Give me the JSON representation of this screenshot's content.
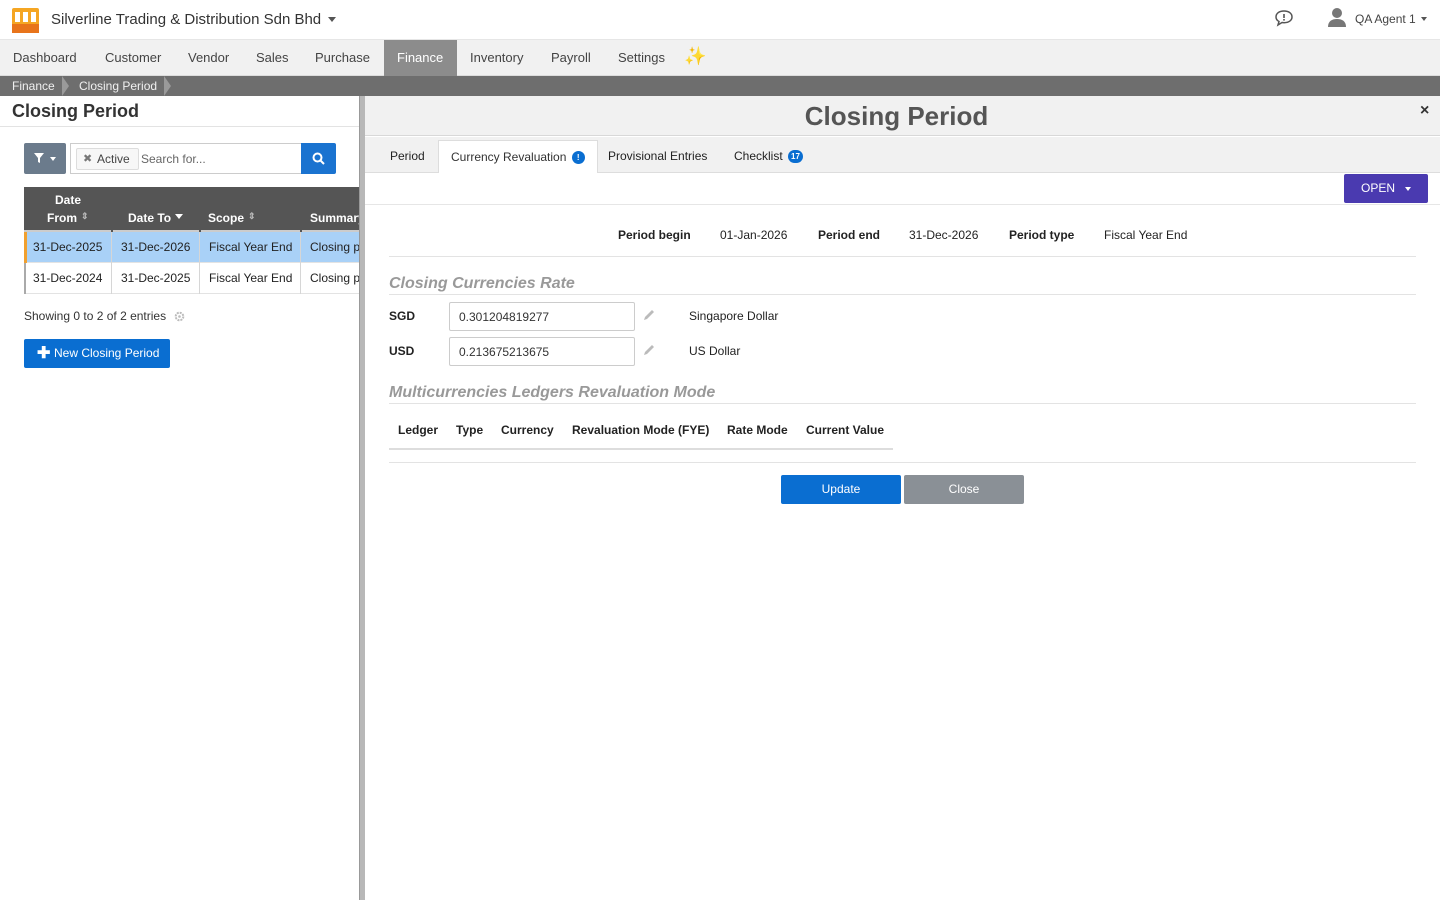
{
  "topbar": {
    "company": "Silverline Trading & Distribution Sdn Bhd",
    "user_name": "QA Agent 1"
  },
  "nav": [
    "Dashboard",
    "Customer",
    "Vendor",
    "Sales",
    "Purchase",
    "Finance",
    "Inventory",
    "Payroll",
    "Settings"
  ],
  "nav_active": "Finance",
  "breadcrumb": [
    "Finance",
    "Closing Period"
  ],
  "left": {
    "title": "Closing Period",
    "filter_tag": "Active",
    "search_placeholder": "Search for...",
    "columns": [
      "Date",
      "From",
      "Date To",
      "Scope",
      "Summary"
    ],
    "rows": [
      {
        "from": "31-Dec-2025",
        "to": "31-Dec-2026",
        "scope": "Fiscal Year End",
        "summary": "Closing p"
      },
      {
        "from": "31-Dec-2024",
        "to": "31-Dec-2025",
        "scope": "Fiscal Year End",
        "summary": "Closing p"
      }
    ],
    "showing": "Showing 0 to 2 of 2 entries",
    "new_button": "New Closing Period"
  },
  "panel": {
    "title": "Closing Period",
    "close": "×",
    "tabs": [
      {
        "label": "Period",
        "badge": ""
      },
      {
        "label": "Currency Revaluation",
        "badge": "!"
      },
      {
        "label": "Provisional Entries",
        "badge": ""
      },
      {
        "label": "Checklist",
        "badge": "17"
      }
    ],
    "status_button": "OPEN",
    "period_begin_label": "Period begin",
    "period_begin": "01-Jan-2026",
    "period_end_label": "Period end",
    "period_end": "31-Dec-2026",
    "period_type_label": "Period type",
    "period_type": "Fiscal Year End",
    "rates_title": "Closing Currencies Rate",
    "rates": [
      {
        "code": "SGD",
        "value": "0.301204819277",
        "name": "Singapore Dollar"
      },
      {
        "code": "USD",
        "value": "0.213675213675",
        "name": "US Dollar"
      }
    ],
    "ledgers_title": "Multicurrencies Ledgers Revaluation Mode",
    "ledger_columns": [
      "Ledger",
      "Type",
      "Currency",
      "Revaluation Mode (FYE)",
      "Rate Mode",
      "Current Value"
    ],
    "update_button": "Update",
    "close_button": "Close"
  },
  "colors": {
    "accent": "#0a6ed1",
    "status_button": "#4a3ab0",
    "nav_active": "#8c8c8c",
    "selected_row": "#a9d1f7"
  }
}
